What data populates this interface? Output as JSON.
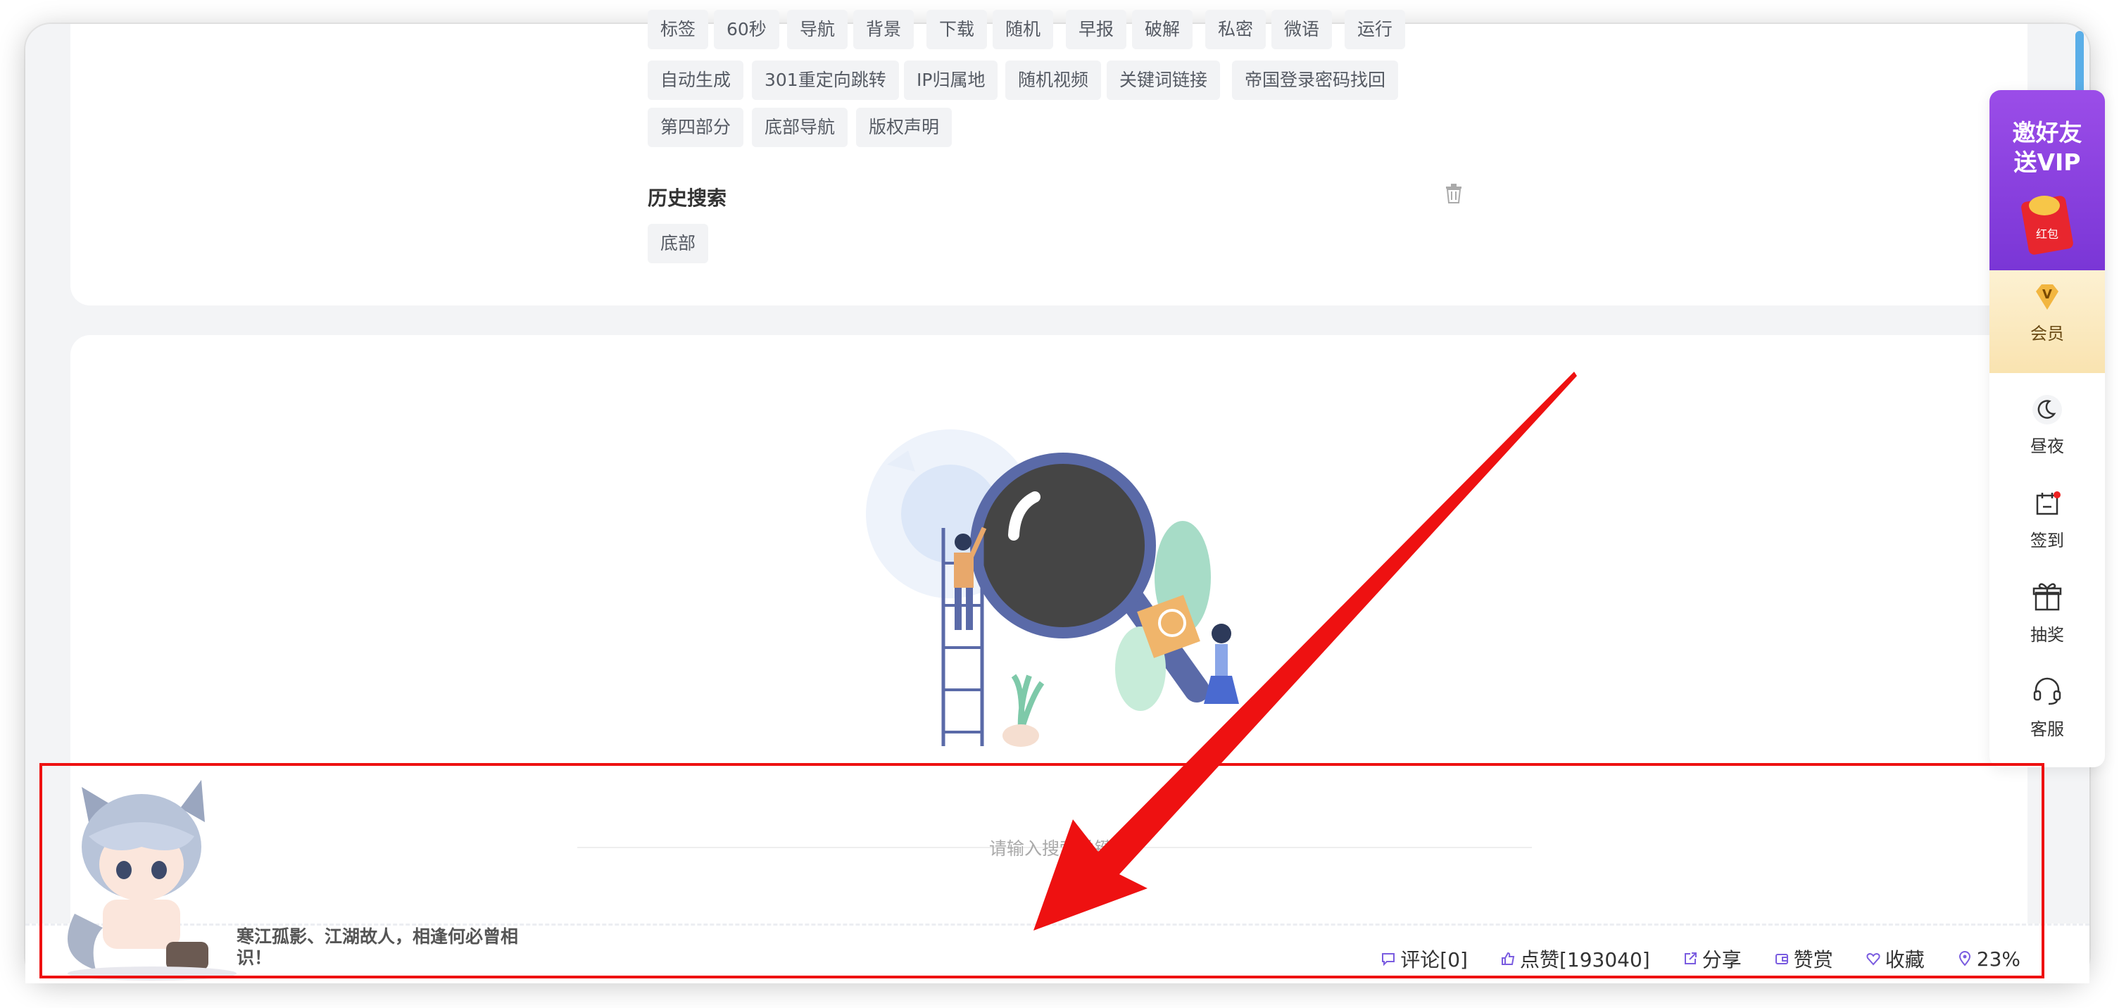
{
  "tags": {
    "row1": [
      "标签",
      "60秒",
      "导航",
      "背景",
      "下载",
      "随机",
      "早报",
      "破解",
      "私密",
      "微语",
      "运行"
    ],
    "row2": [
      "自动生成",
      "301重定向跳转",
      "IP归属地",
      "随机视频",
      "关键词链接",
      "帝国登录密码找回"
    ],
    "row3": [
      "第四部分",
      "底部导航",
      "版权声明"
    ]
  },
  "history": {
    "title": "历史搜索",
    "items": [
      "底部"
    ]
  },
  "search": {
    "hint": "请输入搜索关键词"
  },
  "footer": {
    "quote": "寒江孤影、江湖故人，相逢何必曾相识！",
    "comment": "评论[0]",
    "like": "点赞[193040]",
    "share": "分享",
    "reward": "赞赏",
    "favorite": "收藏",
    "progress": "23%"
  },
  "sidebar": {
    "promo": "邀好友送VIP",
    "redpacket": "红包",
    "vip": "会员",
    "night": "昼夜",
    "checkin": "签到",
    "lottery": "抽奖",
    "service": "客服"
  },
  "colors": {
    "accent_purple": "#8a3fe0",
    "annotation_red": "#ee1111",
    "scrollbar": "#5aaee8",
    "vip_gold": "#f9e3b0"
  }
}
